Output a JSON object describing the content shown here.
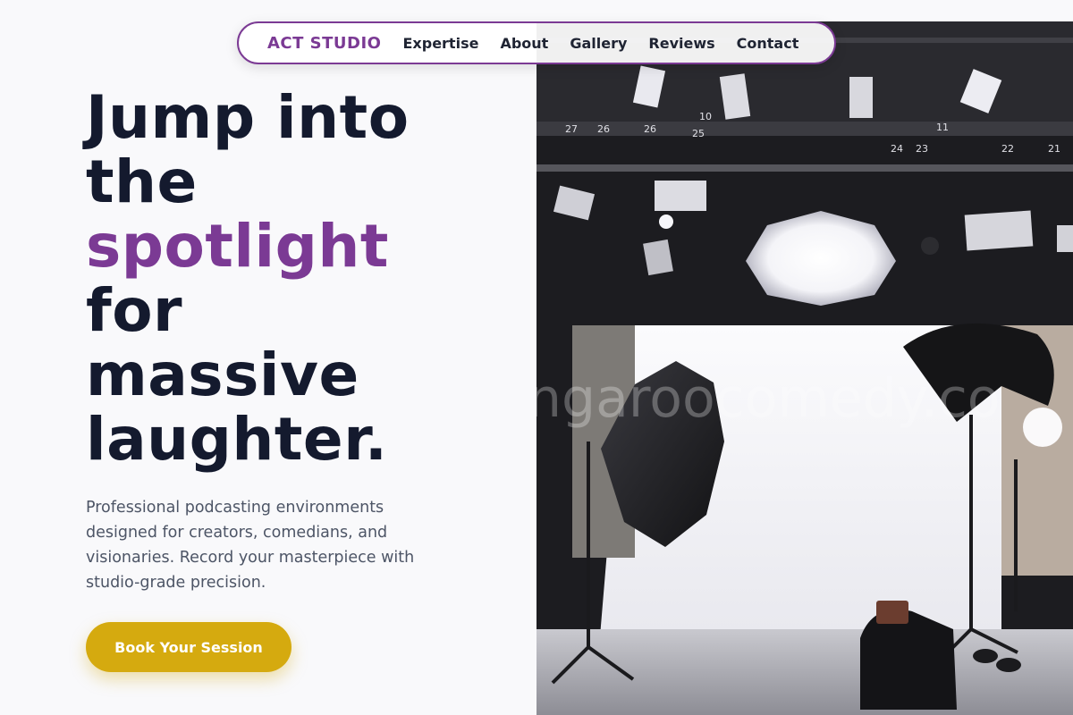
{
  "nav": {
    "brand": "ACT STUDIO",
    "links": [
      "Expertise",
      "About",
      "Gallery",
      "Reviews",
      "Contact"
    ]
  },
  "hero": {
    "headline_lines": [
      "Jump into",
      "the",
      "spotlight",
      "for",
      "massive",
      "laughter."
    ],
    "accent_line_index": 2,
    "subtitle": "Professional podcasting environments designed for creators, comedians, and visionaries. Record your masterpiece with studio-grade precision.",
    "cta_label": "Book Your Session"
  },
  "photo": {
    "description_icon": "studio-photo",
    "watermark": "ngaroocomedy.co",
    "rig_labels": [
      "27",
      "26",
      "26",
      "25",
      "10",
      "11",
      "24",
      "23",
      "22",
      "21"
    ]
  },
  "colors": {
    "accent_purple": "#7b3a94",
    "headline": "#141a2e",
    "cta_gold": "#d5aa0f",
    "background": "#f9f9fb"
  }
}
